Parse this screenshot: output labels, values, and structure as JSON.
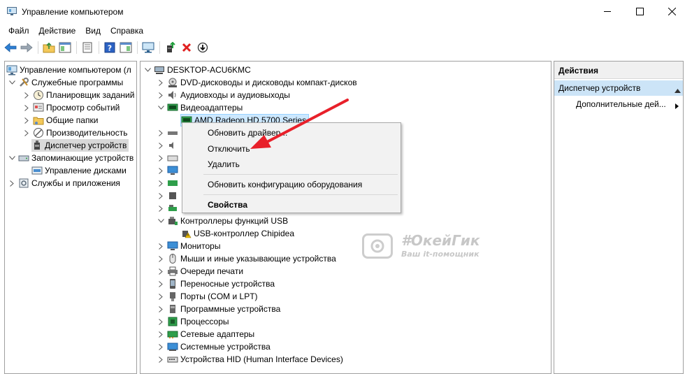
{
  "window": {
    "title": "Управление компьютером",
    "icon": "computer-management-icon"
  },
  "menu": [
    "Файл",
    "Действие",
    "Вид",
    "Справка"
  ],
  "toolbar": {
    "icons": [
      "back-arrow-icon",
      "forward-arrow-icon",
      "up-folder-icon",
      "show-hide-tree-icon",
      "properties-icon",
      "help-icon",
      "show-hide-action-icon",
      "monitor-icon",
      "update-driver-icon",
      "uninstall-icon",
      "disable-icon"
    ]
  },
  "left_tree": {
    "root": "Управление компьютером (л",
    "items": [
      {
        "label": "Служебные программы",
        "indent": 1
      },
      {
        "label": "Планировщик заданий",
        "indent": 2
      },
      {
        "label": "Просмотр событий",
        "indent": 2
      },
      {
        "label": "Общие папки",
        "indent": 2
      },
      {
        "label": "Производительность",
        "indent": 2
      },
      {
        "label": "Диспетчер устройств",
        "indent": 2
      },
      {
        "label": "Запоминающие устройств",
        "indent": 1
      },
      {
        "label": "Управление дисками",
        "indent": 2
      },
      {
        "label": "Службы и приложения",
        "indent": 1
      }
    ]
  },
  "device_tree": {
    "root": "DESKTOP-ACU6KMC",
    "items": [
      {
        "label": "DVD-дисководы и дисководы компакт-дисков"
      },
      {
        "label": "Аудиовходы и аудиовыходы"
      },
      {
        "label": "Видеоадаптеры"
      },
      {
        "label": "AMD Radeon HD 5700 Series"
      },
      {
        "label": ""
      },
      {
        "label": ""
      },
      {
        "label": ""
      },
      {
        "label": ""
      },
      {
        "label": ""
      },
      {
        "label": ""
      },
      {
        "label": ""
      },
      {
        "label": "Контроллеры функций USB"
      },
      {
        "label": "USB-контроллер Chipidea"
      },
      {
        "label": "Мониторы"
      },
      {
        "label": "Мыши и иные указывающие устройства"
      },
      {
        "label": "Очереди печати"
      },
      {
        "label": "Переносные устройства"
      },
      {
        "label": "Порты (COM и LPT)"
      },
      {
        "label": "Программные устройства"
      },
      {
        "label": "Процессоры"
      },
      {
        "label": "Сетевые адаптеры"
      },
      {
        "label": "Системные устройства"
      },
      {
        "label": "Устройства HID (Human Interface Devices)"
      }
    ]
  },
  "context_menu": {
    "items": [
      "Обновить драйвер...",
      "Отключить",
      "Удалить",
      "Обновить конфигурацию оборудования",
      "Свойства"
    ]
  },
  "actions": {
    "header": "Действия",
    "section": "Диспетчер устройств",
    "more": "Дополнительные дей..."
  },
  "watermark": {
    "line1": "#ОкейГик",
    "line2": "Ваш it-помощник"
  },
  "colors": {
    "arrow": "#e8202a",
    "selection": "#cce8ff",
    "section_bg": "#cce4f7"
  }
}
